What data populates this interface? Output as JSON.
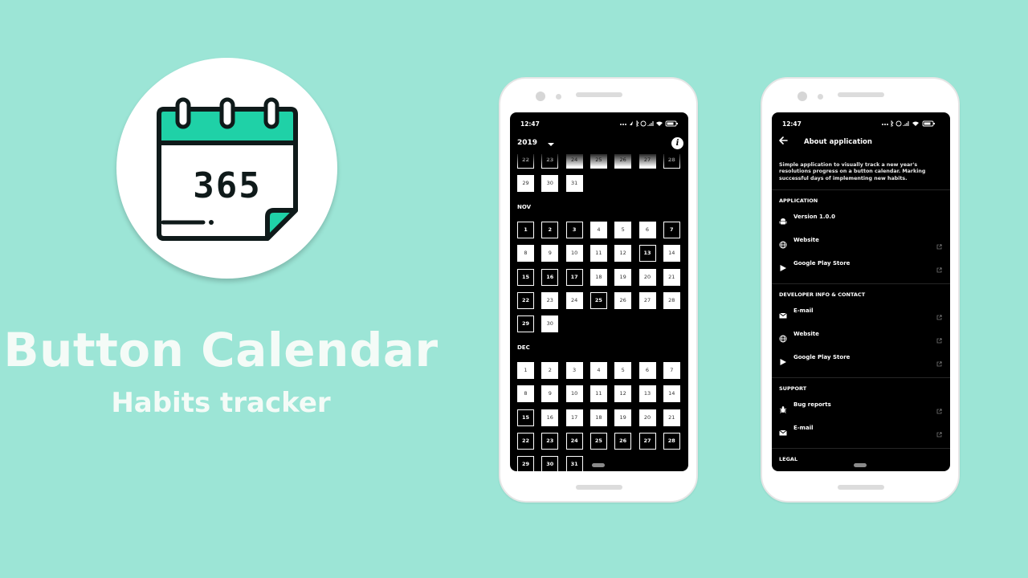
{
  "promo": {
    "logo_text": "365",
    "title": "Button Calendar",
    "subtitle": "Habits tracker"
  },
  "colors": {
    "background": "#9ce5d6",
    "logo_accent": "#1fd1a7",
    "screen_bg": "#000000"
  },
  "calendar_screen": {
    "status_time": "12:47",
    "year": "2019",
    "info_icon": "i",
    "partial_week_1": [
      {
        "d": "22",
        "done": true
      },
      {
        "d": "23",
        "done": true
      },
      {
        "d": "24",
        "done": false
      },
      {
        "d": "25",
        "done": false
      },
      {
        "d": "26",
        "done": false
      },
      {
        "d": "27",
        "done": false
      },
      {
        "d": "28",
        "done": true
      }
    ],
    "partial_week_2": [
      {
        "d": "29",
        "done": false
      },
      {
        "d": "30",
        "done": false
      },
      {
        "d": "31",
        "done": false
      }
    ],
    "months": [
      {
        "label": "NOV",
        "weeks": [
          [
            {
              "d": "1",
              "done": true
            },
            {
              "d": "2",
              "done": true
            },
            {
              "d": "3",
              "done": true
            },
            {
              "d": "4",
              "done": false
            },
            {
              "d": "5",
              "done": false
            },
            {
              "d": "6",
              "done": false
            },
            {
              "d": "7",
              "done": true
            }
          ],
          [
            {
              "d": "8",
              "done": false
            },
            {
              "d": "9",
              "done": false
            },
            {
              "d": "10",
              "done": false
            },
            {
              "d": "11",
              "done": false
            },
            {
              "d": "12",
              "done": false
            },
            {
              "d": "13",
              "done": true
            },
            {
              "d": "14",
              "done": false
            }
          ],
          [
            {
              "d": "15",
              "done": true
            },
            {
              "d": "16",
              "done": true
            },
            {
              "d": "17",
              "done": true
            },
            {
              "d": "18",
              "done": false
            },
            {
              "d": "19",
              "done": false
            },
            {
              "d": "20",
              "done": false
            },
            {
              "d": "21",
              "done": false
            }
          ],
          [
            {
              "d": "22",
              "done": true
            },
            {
              "d": "23",
              "done": false
            },
            {
              "d": "24",
              "done": false
            },
            {
              "d": "25",
              "done": true
            },
            {
              "d": "26",
              "done": false
            },
            {
              "d": "27",
              "done": false
            },
            {
              "d": "28",
              "done": false
            }
          ],
          [
            {
              "d": "29",
              "done": true
            },
            {
              "d": "30",
              "done": false
            }
          ]
        ]
      },
      {
        "label": "DEC",
        "weeks": [
          [
            {
              "d": "1",
              "done": false
            },
            {
              "d": "2",
              "done": false
            },
            {
              "d": "3",
              "done": false
            },
            {
              "d": "4",
              "done": false
            },
            {
              "d": "5",
              "done": false
            },
            {
              "d": "6",
              "done": false
            },
            {
              "d": "7",
              "done": false
            }
          ],
          [
            {
              "d": "8",
              "done": false
            },
            {
              "d": "9",
              "done": false
            },
            {
              "d": "10",
              "done": false
            },
            {
              "d": "11",
              "done": false
            },
            {
              "d": "12",
              "done": false
            },
            {
              "d": "13",
              "done": false
            },
            {
              "d": "14",
              "done": false
            }
          ],
          [
            {
              "d": "15",
              "done": true
            },
            {
              "d": "16",
              "done": false
            },
            {
              "d": "17",
              "done": false
            },
            {
              "d": "18",
              "done": false
            },
            {
              "d": "19",
              "done": false
            },
            {
              "d": "20",
              "done": false
            },
            {
              "d": "21",
              "done": false
            }
          ],
          [
            {
              "d": "22",
              "done": true
            },
            {
              "d": "23",
              "done": true
            },
            {
              "d": "24",
              "done": true
            },
            {
              "d": "25",
              "done": true
            },
            {
              "d": "26",
              "done": true
            },
            {
              "d": "27",
              "done": true
            },
            {
              "d": "28",
              "done": true
            }
          ],
          [
            {
              "d": "29",
              "done": true
            },
            {
              "d": "30",
              "done": true
            },
            {
              "d": "31",
              "done": true
            }
          ]
        ]
      }
    ]
  },
  "about_screen": {
    "status_time": "12:47",
    "title": "About application",
    "description": "Simple application to visually track a new year's resolutions progress on a button calendar. Marking successful days of implementing new habits.",
    "sections": [
      {
        "title": "APPLICATION",
        "items": [
          {
            "label": "Version 1.0.0",
            "icon": "android-icon",
            "external": false
          },
          {
            "label": "Website",
            "icon": "globe-icon",
            "external": true
          },
          {
            "label": "Google Play Store",
            "icon": "play-store-icon",
            "external": true
          }
        ]
      },
      {
        "title": "DEVELOPER INFO & CONTACT",
        "items": [
          {
            "label": "E-mail",
            "icon": "mail-icon",
            "external": true
          },
          {
            "label": "Website",
            "icon": "globe-icon",
            "external": true
          },
          {
            "label": "Google Play Store",
            "icon": "play-store-icon",
            "external": true
          }
        ]
      },
      {
        "title": "SUPPORT",
        "items": [
          {
            "label": "Bug reports",
            "icon": "bug-icon",
            "external": true
          },
          {
            "label": "E-mail",
            "icon": "mail-icon",
            "external": true
          }
        ]
      },
      {
        "title": "LEGAL",
        "items": []
      }
    ]
  }
}
